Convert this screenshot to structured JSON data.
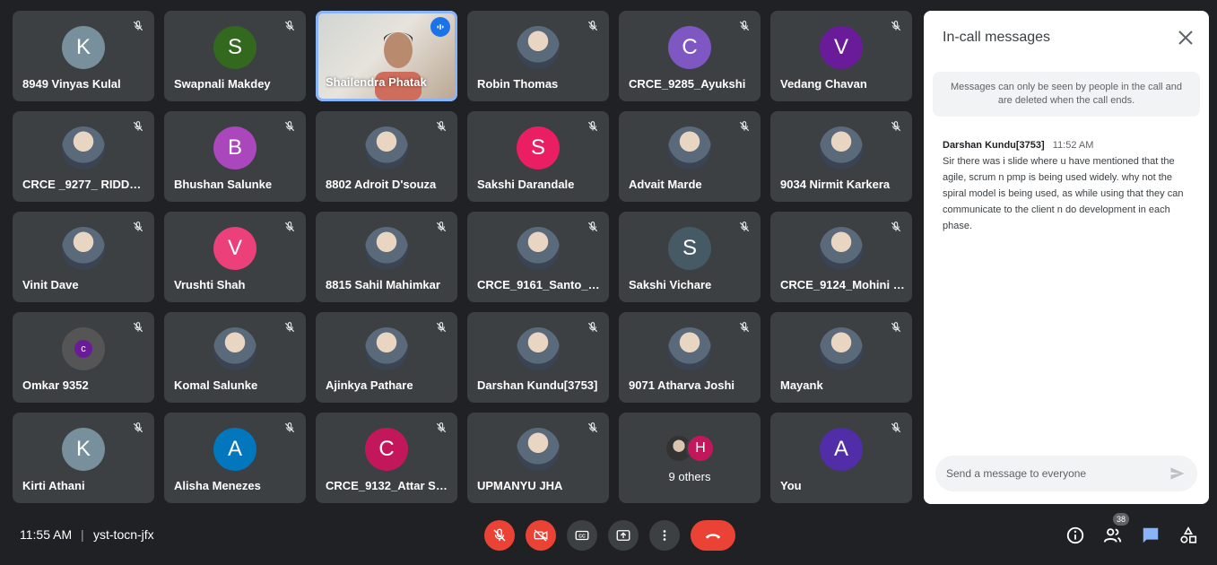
{
  "participants": [
    {
      "name": "8949 Vinyas Kulal",
      "initial": "K",
      "color": "#78909c",
      "type": "avatar"
    },
    {
      "name": "Swapnali Makdey",
      "initial": "S",
      "color": "#33691e",
      "type": "avatar"
    },
    {
      "name": "Shailendra Phatak",
      "type": "video"
    },
    {
      "name": "Robin Thomas",
      "type": "photo"
    },
    {
      "name": "CRCE_9285_Ayukshi",
      "initial": "C",
      "color": "#7e57c2",
      "type": "avatar"
    },
    {
      "name": "Vedang Chavan",
      "initial": "V",
      "color": "#6a1b9a",
      "type": "avatar"
    },
    {
      "name": "CRCE _9277_ RIDDHI ...",
      "type": "photo"
    },
    {
      "name": "Bhushan Salunke",
      "initial": "B",
      "color": "#ab47bc",
      "type": "avatar"
    },
    {
      "name": "8802 Adroit D'souza",
      "type": "photo"
    },
    {
      "name": "Sakshi Darandale",
      "initial": "S",
      "color": "#e91e63",
      "type": "avatar"
    },
    {
      "name": "Advait Marde",
      "type": "photo"
    },
    {
      "name": "9034 Nirmit Karkera",
      "type": "photo"
    },
    {
      "name": "Vinit Dave",
      "type": "photo"
    },
    {
      "name": "Vrushti Shah",
      "initial": "V",
      "color": "#ec407a",
      "type": "avatar"
    },
    {
      "name": "8815 Sahil Mahimkar",
      "type": "photo"
    },
    {
      "name": "CRCE_9161_Santo_Su...",
      "type": "photo"
    },
    {
      "name": "Sakshi Vichare",
      "initial": "S",
      "color": "#455a64",
      "type": "avatar"
    },
    {
      "name": "CRCE_9124_Mohini G...",
      "type": "photo"
    },
    {
      "name": "Omkar 9352",
      "initial": "c",
      "color": "#6a1b9a",
      "type": "photo"
    },
    {
      "name": "Komal Salunke",
      "type": "photo"
    },
    {
      "name": "Ajinkya Pathare",
      "type": "photo"
    },
    {
      "name": "Darshan Kundu[3753]",
      "type": "photo"
    },
    {
      "name": "9071 Atharva Joshi",
      "type": "photo"
    },
    {
      "name": "Mayank",
      "type": "photo"
    },
    {
      "name": "Kirti Athani",
      "initial": "K",
      "color": "#78909c",
      "type": "avatar"
    },
    {
      "name": "Alisha Menezes",
      "initial": "A",
      "color": "#0277bd",
      "type": "avatar"
    },
    {
      "name": "CRCE_9132_Attar Sin...",
      "initial": "C",
      "color": "#c2185b",
      "type": "avatar"
    },
    {
      "name": "UPMANYU JHA",
      "type": "photo"
    },
    {
      "name": "9 others",
      "type": "others",
      "initial": "H"
    },
    {
      "name": "You",
      "initial": "A",
      "color": "#512da8",
      "type": "avatar"
    }
  ],
  "panel": {
    "title": "In-call messages",
    "notice": "Messages can only be seen by people in the call and are deleted when the call ends.",
    "message": {
      "sender": "Darshan Kundu[3753]",
      "time": "11:52 AM",
      "text": "Sir there was i slide where u have mentioned that the agile, scrum n pmp is being used widely. why not the spiral model is being used, as while using that they can communicate to the client n do development in each phase."
    },
    "composer_placeholder": "Send a message to everyone"
  },
  "bottom_bar": {
    "time": "11:55 AM",
    "separator": "|",
    "meeting_code": "yst-tocn-jfx",
    "participants_count": "38"
  },
  "colors": {
    "background": "#202124",
    "tile": "#3c4043",
    "danger": "#ea4335",
    "accent": "#8ab4f8",
    "chat_active": "#1a73e8"
  },
  "icons": {
    "mic_off": "mic-off-icon",
    "camera_off": "camera-off-icon",
    "captions": "captions-icon",
    "present": "present-icon",
    "more": "more-vert-icon",
    "hangup": "hangup-icon",
    "info": "info-icon",
    "people": "people-icon",
    "chat": "chat-icon",
    "activities": "activities-icon",
    "close": "close-icon",
    "send": "send-icon"
  }
}
